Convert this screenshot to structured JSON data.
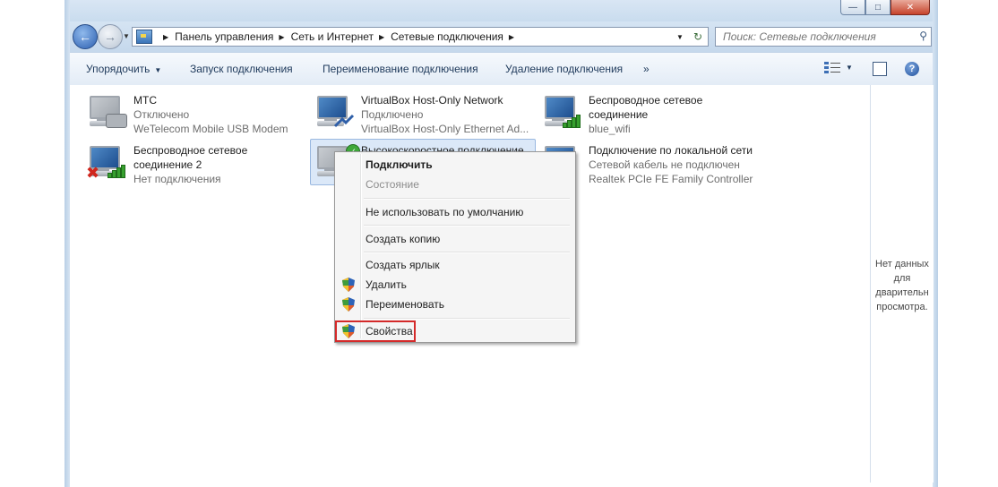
{
  "window": {
    "caption_buttons": {
      "minimize": "—",
      "maximize": "□",
      "close": "✕"
    }
  },
  "address": {
    "crumbs": [
      "Панель управления",
      "Сеть и Интернет",
      "Сетевые подключения"
    ],
    "search_placeholder": "Поиск: Сетевые подключения"
  },
  "toolbar": {
    "organize": "Упорядочить",
    "start_connection": "Запуск подключения",
    "rename_connection": "Переименование подключения",
    "delete_connection": "Удаление подключения",
    "more": "»"
  },
  "connections": [
    {
      "name": "МТС",
      "status": "Отключено",
      "device": "WeTelecom Mobile USB Modem"
    },
    {
      "name": "VirtualBox Host-Only Network",
      "status": "Подключено",
      "device": "VirtualBox Host-Only Ethernet Ad..."
    },
    {
      "name": "Беспроводное сетевое",
      "name2": "соединение",
      "status": "blue_wifi"
    },
    {
      "name": "Беспроводное сетевое",
      "name2": "соединение 2",
      "status": "Нет подключения"
    },
    {
      "name": "Высокоскоростное подключение"
    },
    {
      "name": "Подключение по локальной сети",
      "status": "Сетевой кабель не подключен",
      "device": "Realtek PCIe FE Family Controller"
    }
  ],
  "context_menu": {
    "connect": "Подключить",
    "status": "Состояние",
    "not_default": "Не использовать по умолчанию",
    "create_copy": "Создать копию",
    "create_shortcut": "Создать ярлык",
    "delete": "Удалить",
    "rename": "Переименовать",
    "properties": "Свойства"
  },
  "preview_pane": {
    "lines": [
      "Нет данных",
      "для",
      "дварительн",
      "просмотра."
    ]
  },
  "colors": {
    "selection": "#dbe8f8",
    "highlight_border": "#d42a2a",
    "link_text": "#1e395b"
  }
}
